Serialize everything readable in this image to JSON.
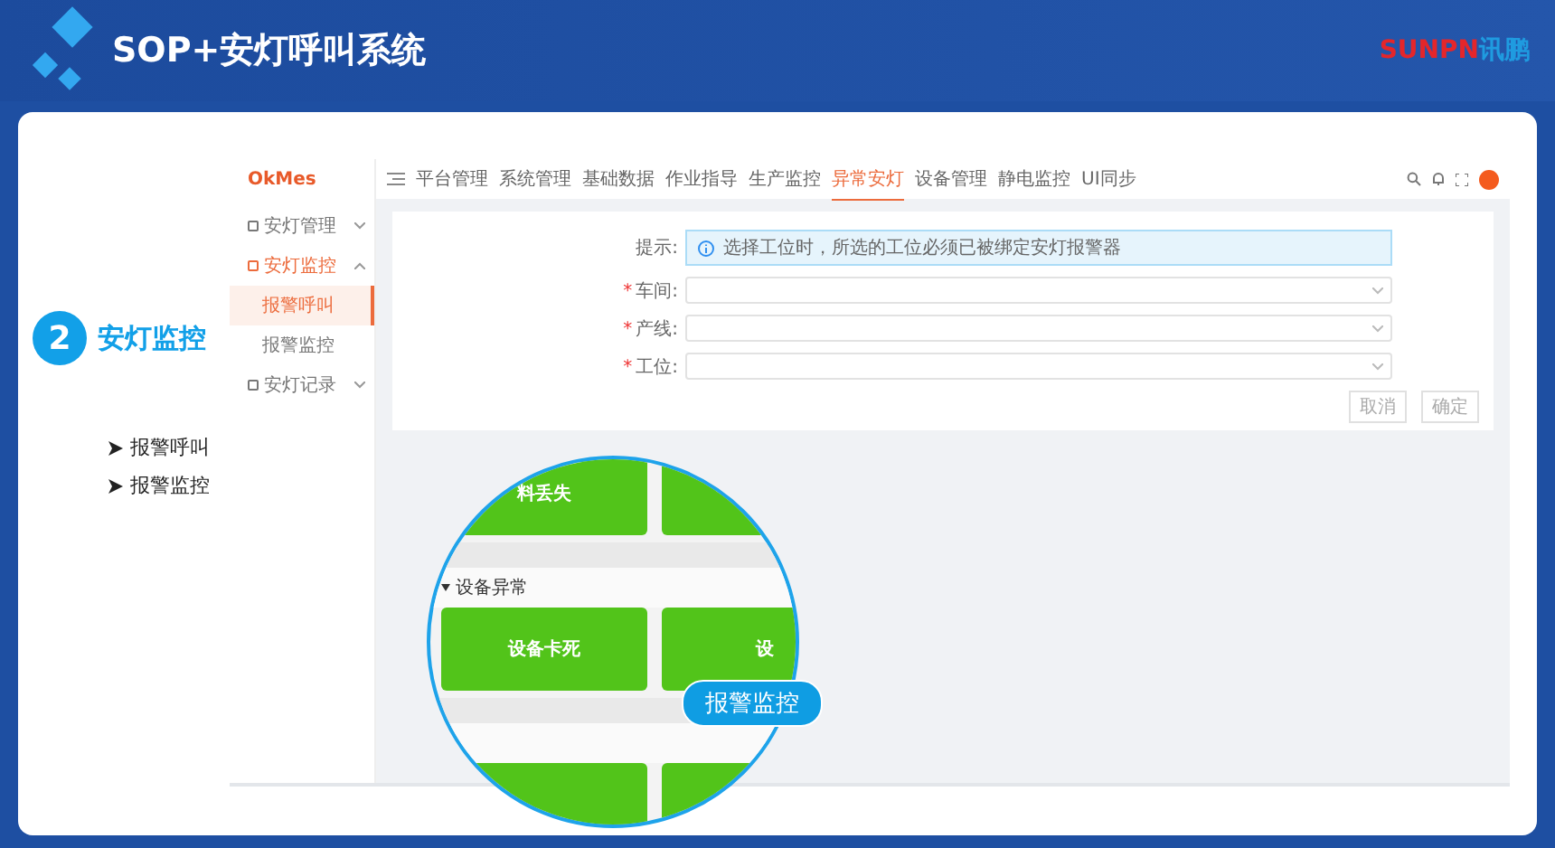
{
  "slide": {
    "title": "SOP+安灯呼叫系统",
    "brand_latin": "SUNPN",
    "brand_cjk": "讯鹏"
  },
  "section": {
    "number": "2",
    "title": "安灯监控",
    "bullets": [
      "报警呼叫",
      "报警监控"
    ]
  },
  "app": {
    "logo": "OkMes",
    "nav": [
      {
        "label": "平台管理",
        "selected": false
      },
      {
        "label": "系统管理",
        "selected": false
      },
      {
        "label": "基础数据",
        "selected": false
      },
      {
        "label": "作业指导",
        "selected": false
      },
      {
        "label": "生产监控",
        "selected": false
      },
      {
        "label": "异常安灯",
        "selected": true
      },
      {
        "label": "设备管理",
        "selected": false
      },
      {
        "label": "静电监控",
        "selected": false
      },
      {
        "label": "UI同步",
        "selected": false
      }
    ],
    "sidebar": [
      {
        "label": "安灯管理",
        "active": false,
        "expanded": false
      },
      {
        "label": "安灯监控",
        "active": true,
        "expanded": true,
        "children": [
          {
            "label": "报警呼叫",
            "selected": true
          },
          {
            "label": "报警监控",
            "selected": false
          }
        ]
      },
      {
        "label": "安灯记录",
        "active": false,
        "expanded": false
      }
    ],
    "form": {
      "tip_label": "提示:",
      "tip": "选择工位时，所选的工位必须已被绑定安灯报警器",
      "fields": [
        {
          "label": "车间:",
          "required": true
        },
        {
          "label": "产线:",
          "required": true
        },
        {
          "label": "工位:",
          "required": true
        }
      ],
      "required_mark": "*",
      "buttons": [
        "取消",
        "确定"
      ]
    }
  },
  "magnifier": {
    "groups": [
      {
        "tiles": [
          "料丢失"
        ]
      },
      {
        "title": "设备异常",
        "tiles": [
          "设备卡死",
          "设"
        ]
      }
    ],
    "callout": "报警监控"
  }
}
